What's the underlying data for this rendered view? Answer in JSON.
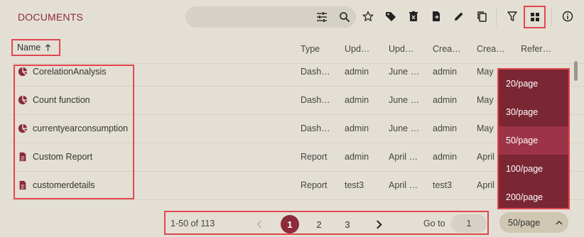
{
  "header": {
    "title": "DOCUMENTS",
    "search": {
      "placeholder": ""
    },
    "toolbar": [
      {
        "icon": "star-icon"
      },
      {
        "icon": "tag-icon"
      },
      {
        "icon": "delete-icon"
      },
      {
        "icon": "export-file-icon"
      },
      {
        "icon": "edit-pencil-icon"
      },
      {
        "icon": "copy-icon"
      },
      {
        "icon": "filter-icon"
      },
      {
        "icon": "grid-view-icon"
      },
      {
        "icon": "info-icon"
      }
    ]
  },
  "columns": {
    "name": "Name",
    "type": "Type",
    "updated_by": "Upd…",
    "updated_on": "Upd…",
    "created_by": "Crea…",
    "created_on": "Crea…",
    "references": "Refer…"
  },
  "rows": [
    {
      "icon": "dashboard-icon",
      "name": "CorelationAnalysis",
      "type": "Dash…",
      "updated_by": "admin",
      "updated_on": "June …",
      "created_by": "admin",
      "created_on": "May …"
    },
    {
      "icon": "dashboard-icon",
      "name": "Count function",
      "type": "Dash…",
      "updated_by": "admin",
      "updated_on": "June …",
      "created_by": "admin",
      "created_on": "May …"
    },
    {
      "icon": "dashboard-icon",
      "name": "currentyearconsumption",
      "type": "Dash…",
      "updated_by": "admin",
      "updated_on": "June …",
      "created_by": "admin",
      "created_on": "May …"
    },
    {
      "icon": "report-icon",
      "name": "Custom Report",
      "type": "Report",
      "updated_by": "admin",
      "updated_on": "April …",
      "created_by": "admin",
      "created_on": "April …"
    },
    {
      "icon": "report-icon",
      "name": "customerdetails",
      "type": "Report",
      "updated_by": "test3",
      "updated_on": "April …",
      "created_by": "test3",
      "created_on": "April …"
    }
  ],
  "page_size_options": [
    "20/page",
    "30/page",
    "50/page",
    "100/page",
    "200/page"
  ],
  "selected_page_size": "50/page",
  "pagination": {
    "range_text": "1-50 of 113",
    "pages": [
      "1",
      "2",
      "3"
    ],
    "current_page": "1",
    "goto_label": "Go to",
    "goto_value": "1"
  },
  "colors": {
    "accent": "#8b2b3a",
    "dropdown_bg": "#7a2633",
    "dropdown_selected": "#9c3346",
    "highlight_outline": "#e0474f",
    "background": "#e4dfd4"
  }
}
